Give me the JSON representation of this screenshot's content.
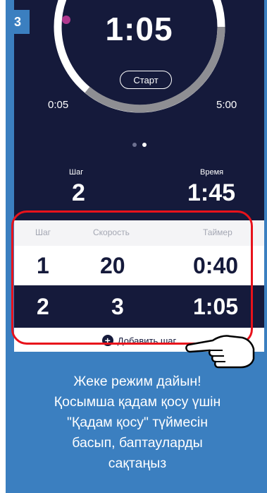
{
  "step_badge": "3",
  "timer": {
    "current": "1:05",
    "start_label": "Старт",
    "range_min": "0:05",
    "range_max": "5:00",
    "page_count": 2,
    "active_page": 2
  },
  "summary": {
    "step_label": "Шаг",
    "step_value": "2",
    "time_label": "Время",
    "time_value": "1:45"
  },
  "table": {
    "headers": [
      "Шаг",
      "Скорость",
      "Таймер"
    ],
    "rows": [
      {
        "step": "1",
        "speed": "20",
        "timer": "0:40"
      },
      {
        "step": "2",
        "speed": "3",
        "timer": "1:05"
      }
    ]
  },
  "add_step_label": "Добавить шаг",
  "caption": [
    "Жеке режим дайын!",
    "Қосымша қадам қосу үшін",
    "\"Қадам қосу\" түймесін",
    "басып, баптауларды",
    "сақтаңыз"
  ],
  "colors": {
    "navy": "#151a3b",
    "frame_blue": "#3b7fc0",
    "highlight_red": "#e8121b",
    "ring_gray": "#8e8e93",
    "ring_marker": "#b0398f"
  },
  "icons": {
    "add": "plus-circle-icon",
    "pointer": "pointing-hand-icon"
  }
}
